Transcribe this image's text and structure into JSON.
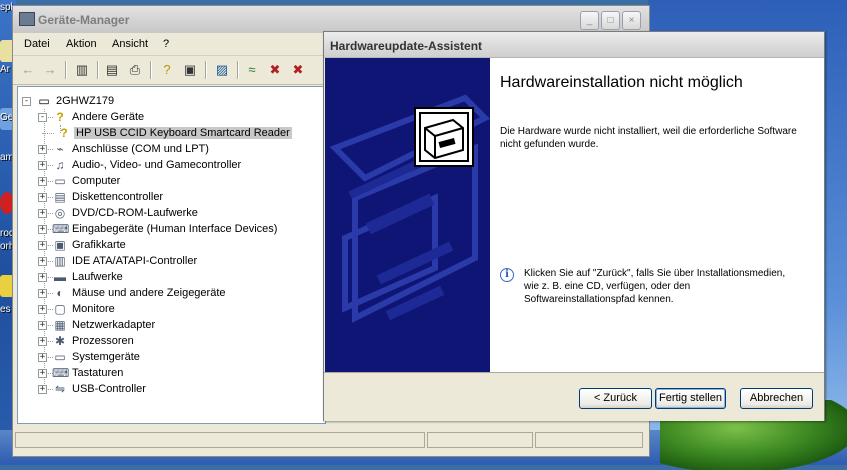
{
  "desktop": {
    "labels": [
      "spl",
      "Ar",
      "Ge",
      "amr",
      "roc",
      "orh",
      "es"
    ]
  },
  "device_manager": {
    "title": "Geräte-Manager",
    "window_buttons": [
      "_",
      "□",
      "×"
    ],
    "menu": [
      "Datei",
      "Aktion",
      "Ansicht",
      "?"
    ],
    "tree": {
      "root": "2GHWZ179",
      "items": [
        {
          "label": "Andere Geräte",
          "icon": "unknown-device-icon",
          "glyph": "?",
          "expanded": true
        },
        {
          "label": "HP USB CCID Keyboard Smartcard Reader",
          "icon": "warning-device-icon",
          "glyph": "?",
          "child": true,
          "selected": true
        },
        {
          "label": "Anschlüsse (COM und LPT)",
          "icon": "port-icon",
          "glyph": "⌁"
        },
        {
          "label": "Audio-, Video- und Gamecontroller",
          "icon": "speaker-icon",
          "glyph": "♫"
        },
        {
          "label": "Computer",
          "icon": "computer-icon",
          "glyph": "▭"
        },
        {
          "label": "Diskettencontroller",
          "icon": "floppy-icon",
          "glyph": "▤"
        },
        {
          "label": "DVD/CD-ROM-Laufwerke",
          "icon": "cdrom-icon",
          "glyph": "◎"
        },
        {
          "label": "Eingabegeräte (Human Interface Devices)",
          "icon": "hid-icon",
          "glyph": "⌨"
        },
        {
          "label": "Grafikkarte",
          "icon": "display-adapter-icon",
          "glyph": "▣"
        },
        {
          "label": "IDE ATA/ATAPI-Controller",
          "icon": "ide-controller-icon",
          "glyph": "▥"
        },
        {
          "label": "Laufwerke",
          "icon": "disk-drive-icon",
          "glyph": "▬"
        },
        {
          "label": "Mäuse und andere Zeigegeräte",
          "icon": "mouse-icon",
          "glyph": "◐"
        },
        {
          "label": "Monitore",
          "icon": "monitor-icon",
          "glyph": "▢"
        },
        {
          "label": "Netzwerkadapter",
          "icon": "network-adapter-icon",
          "glyph": "▦"
        },
        {
          "label": "Prozessoren",
          "icon": "processor-icon",
          "glyph": "✱"
        },
        {
          "label": "Systemgeräte",
          "icon": "system-device-icon",
          "glyph": "▭"
        },
        {
          "label": "Tastaturen",
          "icon": "keyboard-icon",
          "glyph": "⌨"
        },
        {
          "label": "USB-Controller",
          "icon": "usb-icon",
          "glyph": "⇋"
        }
      ]
    }
  },
  "wizard": {
    "title": "Hardwareupdate-Assistent",
    "heading": "Hardwareinstallation nicht möglich",
    "message": "Die Hardware wurde nicht installiert, weil die erforderliche Software nicht gefunden wurde.",
    "hint": "Klicken Sie auf \"Zurück\", falls Sie über Installationsmedien, wie z. B. eine CD, verfügen, oder den Softwareinstallationspfad kennen.",
    "buttons": {
      "back": "< Zurück",
      "finish": "Fertig stellen",
      "cancel": "Abbrechen"
    },
    "info_glyph": "i"
  },
  "colors": {
    "wizard_side": "#0f1574",
    "selection": "#c8c8c8",
    "button_border": "#003c74"
  }
}
